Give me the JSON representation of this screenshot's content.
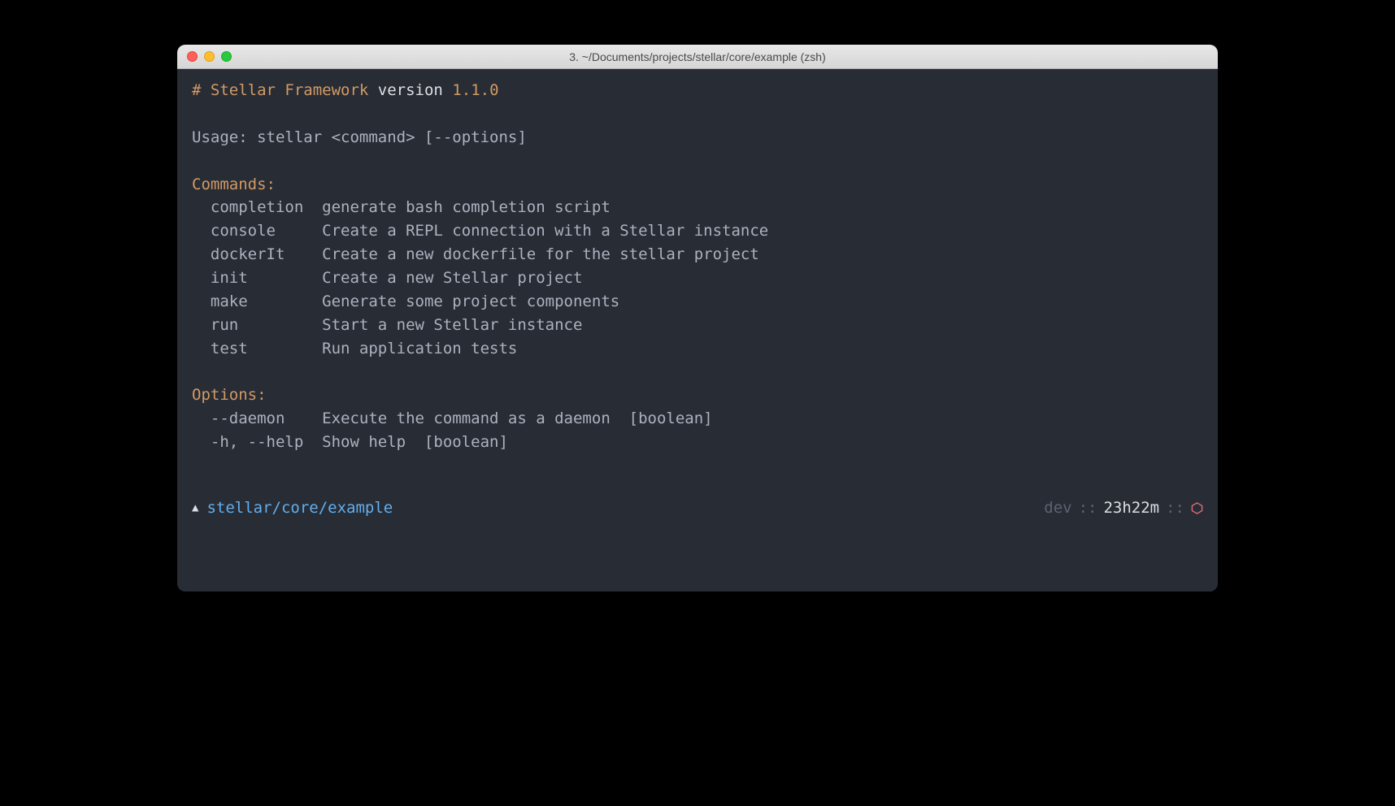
{
  "window": {
    "title": "3. ~/Documents/projects/stellar/core/example (zsh)"
  },
  "header": {
    "prefix": "# ",
    "name": "Stellar Framework",
    "version_label": " version ",
    "version": "1.1.0"
  },
  "usage": "Usage: stellar <command> [--options]",
  "commands_label": "Commands:",
  "commands": [
    {
      "name": "completion",
      "desc": "generate bash completion script"
    },
    {
      "name": "console",
      "desc": "Create a REPL connection with a Stellar instance"
    },
    {
      "name": "dockerIt",
      "desc": "Create a new dockerfile for the stellar project"
    },
    {
      "name": "init",
      "desc": "Create a new Stellar project"
    },
    {
      "name": "make",
      "desc": "Generate some project components"
    },
    {
      "name": "run",
      "desc": "Start a new Stellar instance"
    },
    {
      "name": "test",
      "desc": "Run application tests"
    }
  ],
  "options_label": "Options:",
  "options": [
    {
      "flag": "--daemon",
      "desc": "Execute the command as a daemon  [boolean]"
    },
    {
      "flag": "-h, --help",
      "desc": "Show help  [boolean]"
    }
  ],
  "prompt": {
    "triangle": "▲",
    "path": "stellar/core/example",
    "branch": "dev",
    "sep": " :: ",
    "time": "23h22m"
  }
}
